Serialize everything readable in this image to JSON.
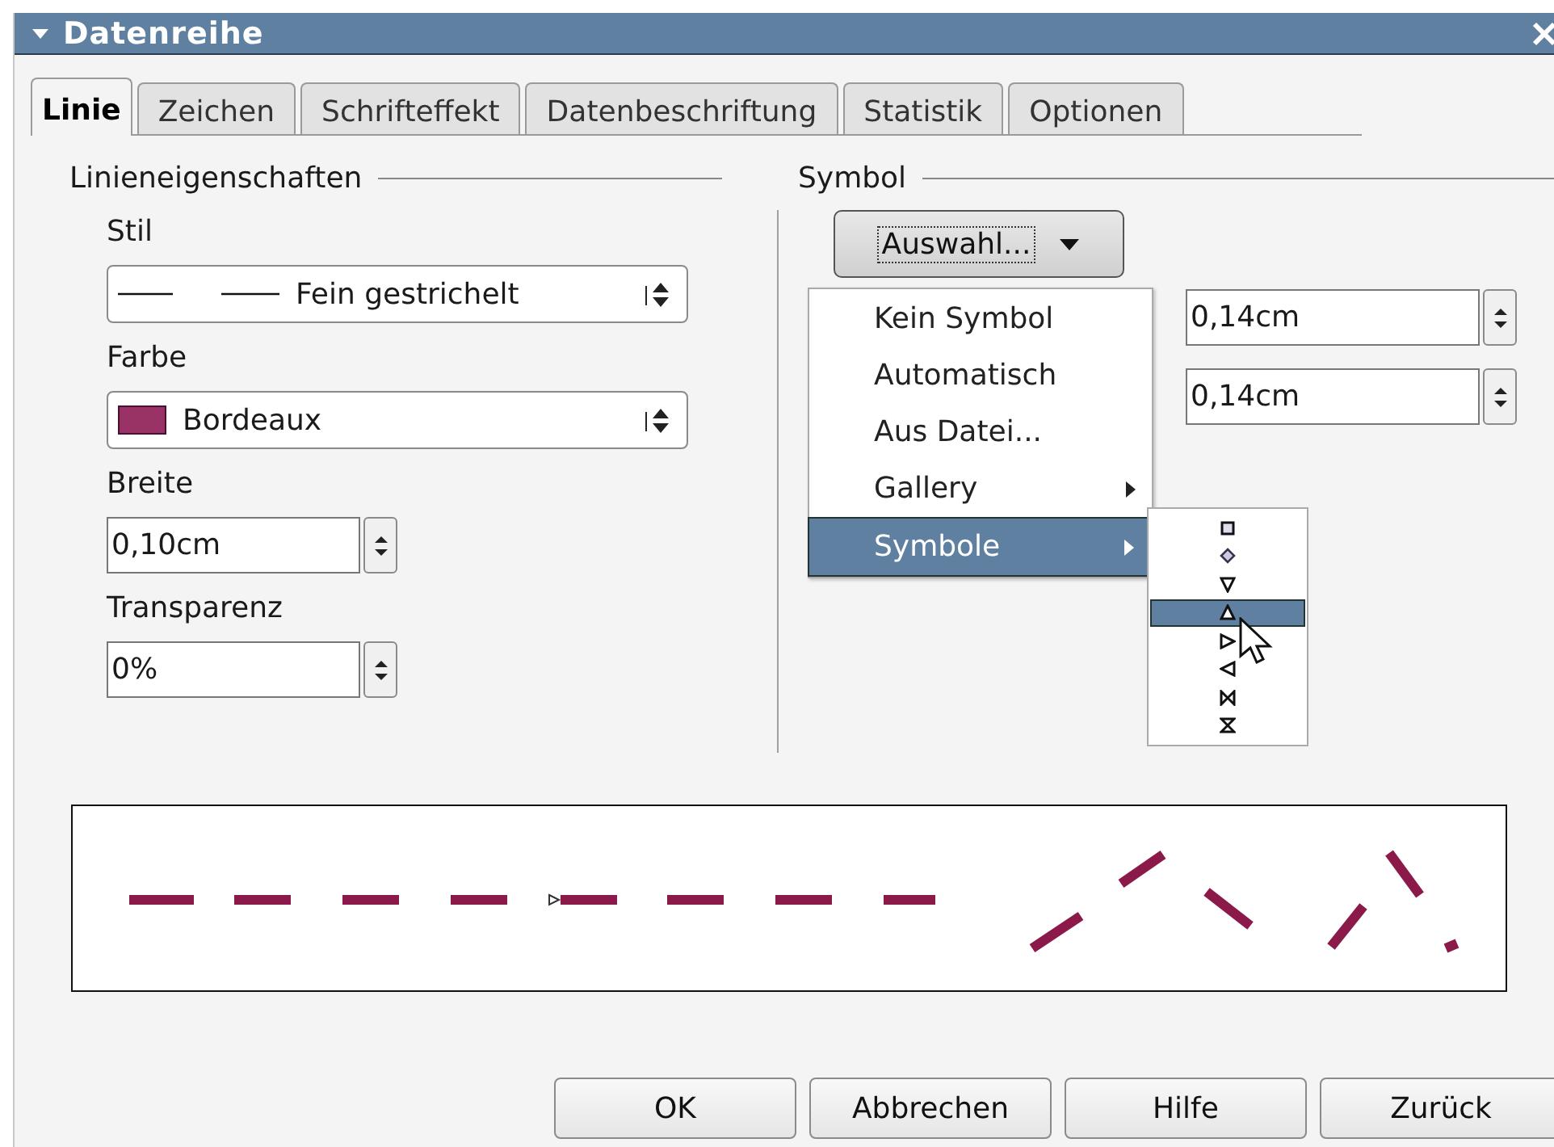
{
  "window": {
    "title": "Datenreihe"
  },
  "tabs": [
    {
      "label": "Linie",
      "selected": true
    },
    {
      "label": "Zeichen",
      "selected": false
    },
    {
      "label": "Schrifteffekt",
      "selected": false
    },
    {
      "label": "Datenbeschriftung",
      "selected": false
    },
    {
      "label": "Statistik",
      "selected": false
    },
    {
      "label": "Optionen",
      "selected": false
    }
  ],
  "line_properties": {
    "heading": "Linieneigenschaften",
    "style": {
      "label": "Stil",
      "value": "Fein gestrichelt"
    },
    "color": {
      "label": "Farbe",
      "value": "Bordeaux"
    },
    "width": {
      "label": "Breite",
      "value": "0,10cm"
    },
    "transparency": {
      "label": "Transparenz",
      "value": "0%"
    }
  },
  "symbol": {
    "heading": "Symbol",
    "select_button": "Auswahl...",
    "width": "0,14cm",
    "height": "0,14cm",
    "menu": [
      {
        "label": "Kein Symbol",
        "submenu": false,
        "selected": false
      },
      {
        "label": "Automatisch",
        "submenu": false,
        "selected": false
      },
      {
        "label": "Aus Datei...",
        "submenu": false,
        "selected": false
      },
      {
        "label": "Gallery",
        "submenu": true,
        "selected": false
      },
      {
        "label": "Symbole",
        "submenu": true,
        "selected": true
      }
    ],
    "submenu": [
      {
        "kind": "square",
        "selected": false
      },
      {
        "kind": "diamond",
        "selected": false
      },
      {
        "kind": "triangle-down",
        "selected": false
      },
      {
        "kind": "triangle-up",
        "selected": true
      },
      {
        "kind": "triangle-right",
        "selected": false
      },
      {
        "kind": "triangle-left",
        "selected": false
      },
      {
        "kind": "bowtie",
        "selected": false
      },
      {
        "kind": "hourglass",
        "selected": false
      }
    ]
  },
  "buttons": [
    {
      "label": "OK"
    },
    {
      "label": "Abbrechen"
    },
    {
      "label": "Hilfe"
    },
    {
      "label": "Zurück"
    }
  ]
}
